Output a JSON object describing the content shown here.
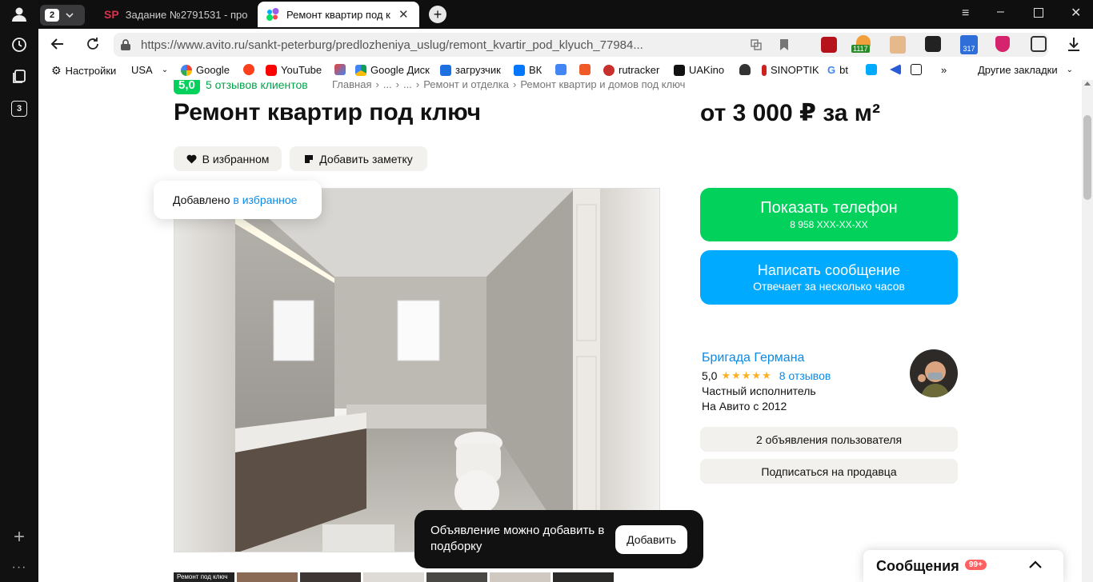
{
  "rail": {
    "tabs_count": "3"
  },
  "tabs": {
    "counter": "2",
    "tab1_label": "Задание №2791531 - про",
    "tab1_icon": "SP",
    "tab2_label": "Ремонт квартир под кл"
  },
  "toolbar": {
    "url": "https://www.avito.ru/sankt-peterburg/predlozheniya_uslug/remont_kvartir_pod_klyuch_77984...",
    "ext_badge1": "1117",
    "ext_badge2": "317"
  },
  "bookmarks": {
    "items": [
      "Настройки",
      "USA",
      "Google",
      "YouTube",
      "Google Диск",
      "загрузчик",
      "ВК",
      "rutracker",
      "UAKino",
      "SINOPTIK",
      "bt"
    ],
    "more": "»",
    "other": "Другие закладки"
  },
  "listing": {
    "rating": "5,0",
    "reviews_link": "5 отзывов клиентов",
    "breadcrumb": [
      "Главная",
      "›",
      "...",
      "›",
      "...",
      "›",
      "Ремонт и отделка",
      "›",
      "Ремонт квартир и домов под ключ"
    ],
    "title": "Ремонт квартир под ключ",
    "price": "от 3 000 ₽ за м²",
    "fav_button": "В избранном",
    "note_button": "Добавить заметку",
    "toast_text": "Добавлено ",
    "toast_link": "в избранное"
  },
  "contact": {
    "phone_title": "Показать телефон",
    "phone_sub": "8 958 XXX-XX-XX",
    "message_title": "Написать сообщение",
    "message_sub": "Отвечает за несколько часов"
  },
  "seller": {
    "name": "Бригада Германа",
    "rating": "5,0",
    "stars": 5,
    "reviews": "8 отзывов",
    "type": "Частный исполнитель",
    "since": "На Авито с 2012",
    "ads_button": "2 объявления пользователя",
    "subscribe_button": "Подписаться на продавца"
  },
  "popup": {
    "text": "Объявление можно добавить в подборку",
    "button": "Добавить"
  },
  "messages": {
    "label": "Сообщения",
    "badge": "99+"
  },
  "thumbs": {
    "first_caption": "Ремонт под ключ"
  },
  "colors": {
    "green": "#02d15c",
    "blue": "#00aaff",
    "link": "#0a8ae6",
    "star": "#ffb021",
    "chip": "#f2f1ee"
  }
}
